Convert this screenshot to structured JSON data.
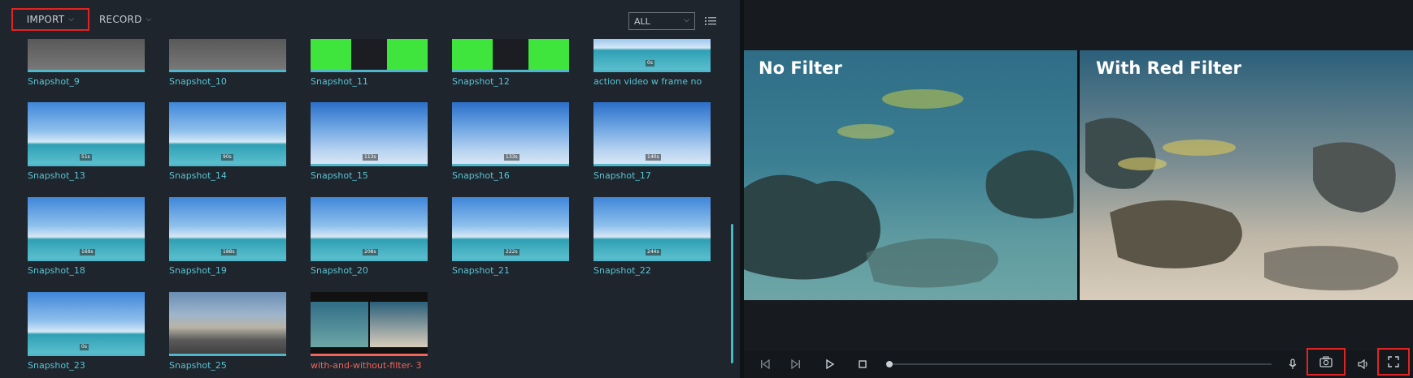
{
  "toolbar": {
    "import_label": "IMPORT",
    "record_label": "RECORD",
    "filter_value": "ALL"
  },
  "media": [
    {
      "label": "Snapshot_9",
      "scene": "road",
      "stamp": ""
    },
    {
      "label": "Snapshot_10",
      "scene": "road",
      "stamp": ""
    },
    {
      "label": "Snapshot_11",
      "scene": "green",
      "stamp": ""
    },
    {
      "label": "Snapshot_12",
      "scene": "green",
      "stamp": ""
    },
    {
      "label": "action video w frame no",
      "scene": "sky",
      "stamp": "0s"
    },
    {
      "label": "Snapshot_13",
      "scene": "sky",
      "stamp": "51s"
    },
    {
      "label": "Snapshot_14",
      "scene": "sky",
      "stamp": "90s"
    },
    {
      "label": "Snapshot_15",
      "scene": "skyfull",
      "stamp": "113s"
    },
    {
      "label": "Snapshot_16",
      "scene": "skyfull",
      "stamp": "133s"
    },
    {
      "label": "Snapshot_17",
      "scene": "skyfull",
      "stamp": "140s"
    },
    {
      "label": "Snapshot_18",
      "scene": "sky",
      "stamp": "169s"
    },
    {
      "label": "Snapshot_19",
      "scene": "sky",
      "stamp": "188s"
    },
    {
      "label": "Snapshot_20",
      "scene": "sky",
      "stamp": "208s"
    },
    {
      "label": "Snapshot_21",
      "scene": "sky",
      "stamp": "222s"
    },
    {
      "label": "Snapshot_22",
      "scene": "sky",
      "stamp": "244s"
    },
    {
      "label": "Snapshot_23",
      "scene": "sky",
      "stamp": "0s"
    },
    {
      "label": "Snapshot_25",
      "scene": "pier",
      "stamp": ""
    },
    {
      "label": "with-and-without-filter- 3",
      "scene": "splitthumb",
      "stamp": "",
      "highlight": true
    }
  ],
  "preview": {
    "left_title": "No Filter",
    "right_title": "With Red Filter"
  },
  "icons": {
    "list_view": "list-view-icon",
    "prev_frame": "skip-back-icon",
    "next_frame": "skip-forward-icon",
    "play": "play-icon",
    "stop": "stop-icon",
    "mic": "microphone-icon",
    "snapshot": "camera-icon",
    "volume": "volume-icon",
    "fullscreen": "fullscreen-icon"
  },
  "colors": {
    "accent": "#58c3d3",
    "highlight_label": "#f0645a",
    "annotation": "#e02424"
  }
}
